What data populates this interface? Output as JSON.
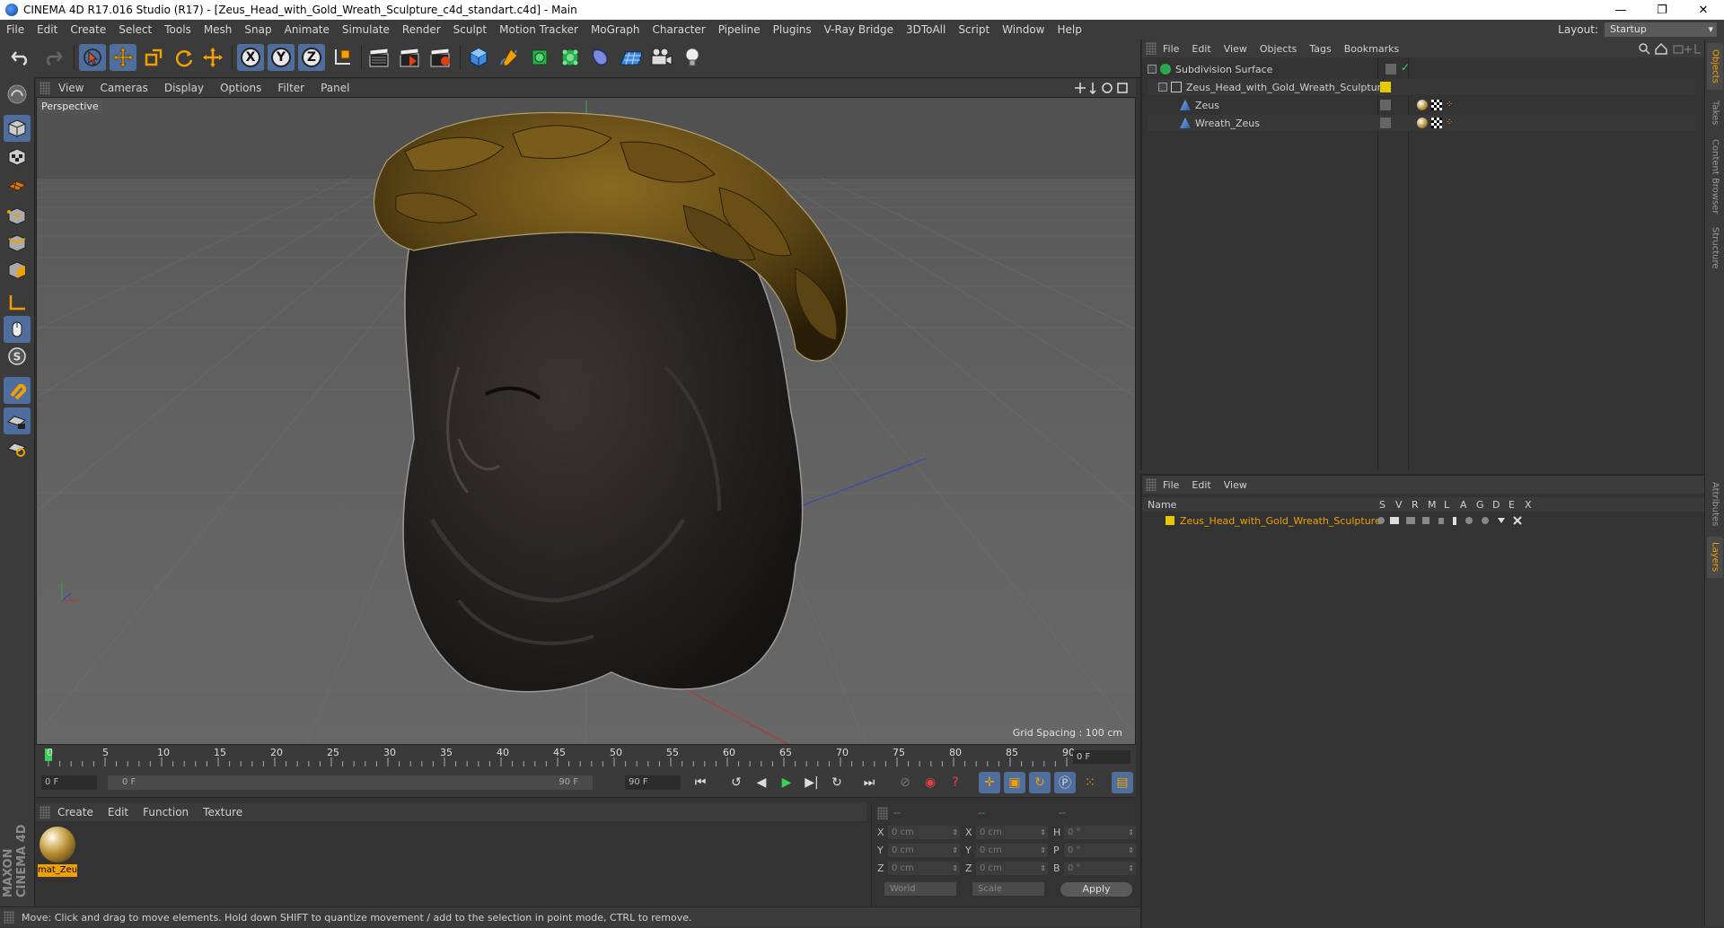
{
  "window": {
    "title": "CINEMA 4D R17.016 Studio (R17) - [Zeus_Head_with_Gold_Wreath_Sculpture_c4d_standart.c4d] - Main",
    "minimize": "—",
    "maximize": "❐",
    "close": "✕"
  },
  "menubar": {
    "items": [
      "File",
      "Edit",
      "Create",
      "Select",
      "Tools",
      "Mesh",
      "Snap",
      "Animate",
      "Simulate",
      "Render",
      "Sculpt",
      "Motion Tracker",
      "MoGraph",
      "Character",
      "Pipeline",
      "Plugins",
      "V-Ray Bridge",
      "3DToAll",
      "Script",
      "Window",
      "Help"
    ],
    "layout_label": "Layout:",
    "layout_value": "Startup"
  },
  "toolbar": {
    "axis_x": "X",
    "axis_y": "Y",
    "axis_z": "Z"
  },
  "viewport": {
    "menu": [
      "View",
      "Cameras",
      "Display",
      "Options",
      "Filter",
      "Panel"
    ],
    "label": "Perspective",
    "grid_spacing": "Grid Spacing : 100 cm"
  },
  "timeline": {
    "ticks": [
      "0",
      "5",
      "10",
      "15",
      "20",
      "25",
      "30",
      "35",
      "40",
      "45",
      "50",
      "55",
      "60",
      "65",
      "70",
      "75",
      "80",
      "85",
      "90"
    ],
    "current_frame": "0 F",
    "start_field": "0 F",
    "range_start": "0 F",
    "range_end": "90 F",
    "end_field": "90 F"
  },
  "material_manager": {
    "menu": [
      "Create",
      "Edit",
      "Function",
      "Texture"
    ],
    "materials": [
      {
        "name": "mat_Zeu"
      }
    ]
  },
  "coordinates": {
    "headers": [
      "--",
      "--",
      "--"
    ],
    "rows": [
      {
        "axis": "X",
        "pos": "0 cm",
        "axis2": "X",
        "size": "0 cm",
        "rlabel": "H",
        "rot": "0 °"
      },
      {
        "axis": "Y",
        "pos": "0 cm",
        "axis2": "Y",
        "size": "0 cm",
        "rlabel": "P",
        "rot": "0 °"
      },
      {
        "axis": "Z",
        "pos": "0 cm",
        "axis2": "Z",
        "size": "0 cm",
        "rlabel": "B",
        "rot": "0 °"
      }
    ],
    "mode_world": "World",
    "mode_scale": "Scale",
    "apply": "Apply"
  },
  "status": {
    "text": "Move: Click and drag to move elements. Hold down SHIFT to quantize movement / add to the selection in point mode, CTRL to remove."
  },
  "object_manager": {
    "menu": [
      "File",
      "Edit",
      "View",
      "Objects",
      "Tags",
      "Bookmarks"
    ],
    "objects": [
      {
        "name": "Subdivision Surface",
        "indent": 0
      },
      {
        "name": "Zeus_Head_with_Gold_Wreath_Sculpture",
        "indent": 1
      },
      {
        "name": "Zeus",
        "indent": 2
      },
      {
        "name": "Wreath_Zeus",
        "indent": 2
      }
    ]
  },
  "layer_manager": {
    "menu": [
      "File",
      "Edit",
      "View"
    ],
    "columns": [
      "Name",
      "S",
      "V",
      "R",
      "M",
      "L",
      "A",
      "G",
      "D",
      "E",
      "X"
    ],
    "layers": [
      {
        "name": "Zeus_Head_with_Gold_Wreath_Sculpture",
        "color": "#e8c800"
      }
    ]
  },
  "right_tabs": [
    "Objects",
    "Takes",
    "Content Browser",
    "Structure",
    "Attributes",
    "Layers"
  ],
  "colors": {
    "accent_blue": "#4f6e9e",
    "highlight_orange": "#f0a000",
    "bronze": "#8a6a20"
  }
}
